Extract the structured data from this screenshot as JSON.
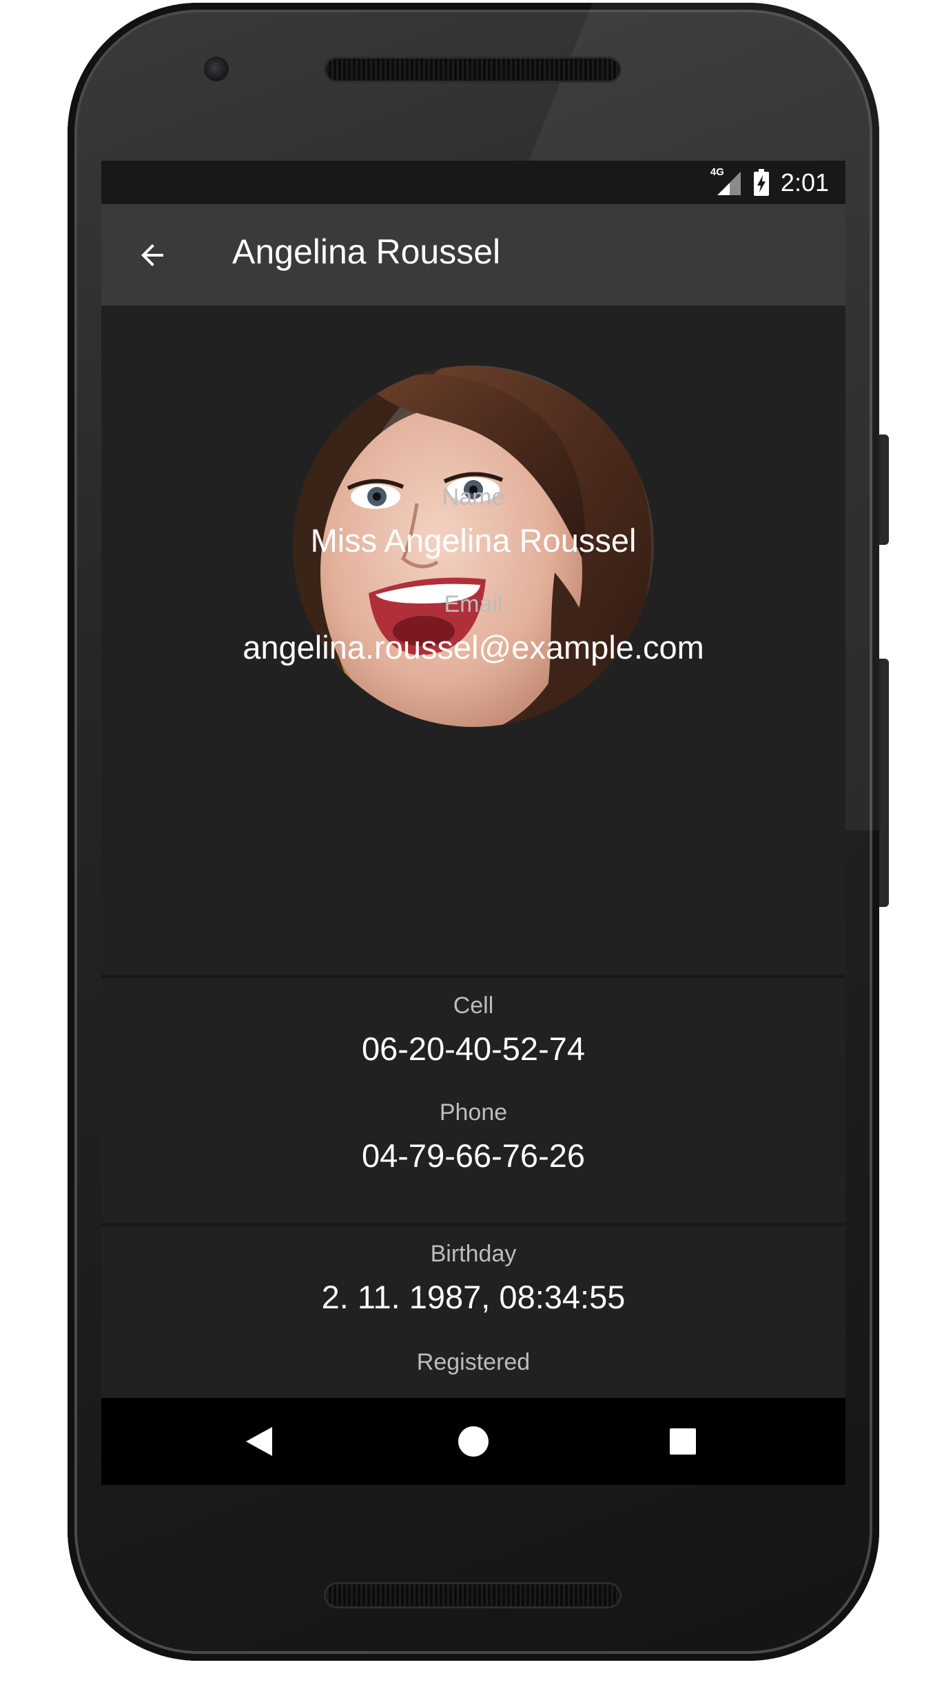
{
  "status_bar": {
    "network_label": "4G",
    "time": "2:01",
    "icons": [
      "signal-icon",
      "battery-charging-icon"
    ]
  },
  "toolbar": {
    "back_icon": "arrow-back-icon",
    "title": "Angelina Roussel"
  },
  "profile": {
    "avatar_icon": "profile-photo"
  },
  "fields": [
    {
      "label": "Name",
      "value": "Miss Angelina Roussel"
    },
    {
      "label": "Email",
      "value": "angelina.roussel@example.com"
    },
    {
      "label": "Cell",
      "value": "06-20-40-52-74"
    },
    {
      "label": "Phone",
      "value": "04-79-66-76-26"
    },
    {
      "label": "Birthday",
      "value": "2. 11. 1987, 08:34:55"
    },
    {
      "label": "Registered",
      "value": ""
    }
  ],
  "navigation": {
    "icons": [
      "nav-back-icon",
      "nav-home-icon",
      "nav-recents-icon"
    ]
  },
  "colors": {
    "screen_background": "#212121",
    "toolbar": "#3a3a3a",
    "status_bar": "#181818",
    "label_text": "#bdbdbd",
    "value_text": "#ffffff",
    "nav_bar": "#000000"
  }
}
